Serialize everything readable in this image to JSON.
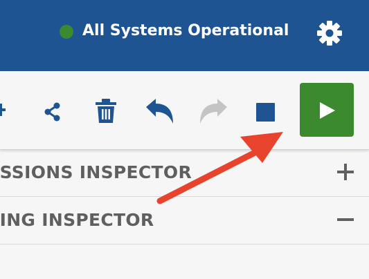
{
  "header": {
    "status_text": "All Systems Operational",
    "status_color": "#3a8a2e",
    "settings_icon": "gear-icon",
    "background": "#1f5492"
  },
  "toolbar": {
    "icons": [
      "plus-icon",
      "share-icon",
      "trash-icon",
      "undo-icon",
      "redo-icon",
      "stop-icon",
      "play-icon"
    ],
    "icon_color": "#1f5492",
    "disabled_color": "#c4c4c4",
    "run_button_color": "#3c8a2e"
  },
  "inspectors": [
    {
      "label": "ISSIONS INSPECTOR",
      "toggle": "plus-icon"
    },
    {
      "label": "IING INSPECTOR",
      "toggle": "minus-icon"
    }
  ],
  "annotation": {
    "arrow_color": "#e8432d"
  }
}
